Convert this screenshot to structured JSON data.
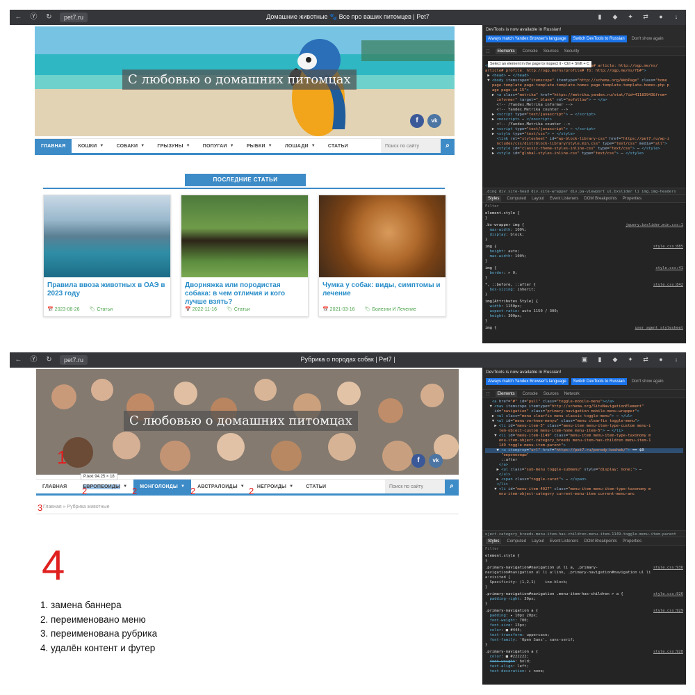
{
  "shot1": {
    "browser": {
      "url": "pet7.ru",
      "title": "Домашние животные 🐾 Все про ваших питомцев | Pet7"
    },
    "banner": {
      "caption": "С любовью о домашних питомцах",
      "social": [
        "f",
        "vk"
      ]
    },
    "menu": {
      "items": [
        {
          "label": "ГЛАВНАЯ",
          "active": true,
          "caret": false
        },
        {
          "label": "КОШКИ",
          "caret": true
        },
        {
          "label": "СОБАКИ",
          "caret": true
        },
        {
          "label": "ГРЫЗУНЫ",
          "caret": true
        },
        {
          "label": "ПОПУГАИ",
          "caret": true
        },
        {
          "label": "РЫБКИ",
          "caret": true
        },
        {
          "label": "ЛОШАДИ",
          "caret": true
        },
        {
          "label": "СТАТЬИ",
          "caret": false
        }
      ],
      "search_placeholder": "Поиск по сайту"
    },
    "latest_heading": "ПОСЛЕДНИЕ СТАТЬИ",
    "cards": [
      {
        "title": "Правила ввоза животных в ОАЭ в 2023 году",
        "date": "2023-08-26",
        "category": "Статьи"
      },
      {
        "title": "Дворняжка или породистая собака: в чем отличия и кого лучше взять?",
        "date": "2022-11-16",
        "category": "Статьи"
      },
      {
        "title": "Чумка у собак: виды, симптомы и лечение",
        "date": "2021-03-16",
        "category": "Болезни И Лечение"
      }
    ],
    "devtools": {
      "notice": "DevTools is now available in Russian!",
      "btn_match": "Always match Yandex Browser's language",
      "btn_switch": "Switch DevTools to Russian",
      "btn_dismiss": "Don't show again",
      "tabs": [
        "Elements",
        "Console",
        "Sources",
        "Security"
      ],
      "tooltip": "Select an element in the page to inspect it - Ctrl + Shift + C",
      "crumbs": ".ding  div.site-head  div.site-wrapper  div.pa-viewport  ul.bxslider  li  img.img-headers",
      "style_tabs": [
        "Styles",
        "Computed",
        "Layout",
        "Event Listeners",
        "DOM Breakpoints",
        "Properties"
      ],
      "filter": "Filter"
    }
  },
  "shot2": {
    "browser": {
      "url": "pet7.ru",
      "title": "Рубрика о породах собак | Pet7 |"
    },
    "banner": {
      "caption": "С любовью о домашних питомцах"
    },
    "menu": {
      "items": [
        {
          "label": "ГЛАВНАЯ",
          "caret": false
        },
        {
          "label": "ЕВРОПЕОИДЫ",
          "caret": true
        },
        {
          "label": "МОНГОЛОИДЫ",
          "caret": true,
          "active": true
        },
        {
          "label": "АВСТРАЛОИДЫ",
          "caret": true
        },
        {
          "label": "НЕГРОИДЫ",
          "caret": true
        },
        {
          "label": "СТАТЬИ",
          "caret": false
        }
      ],
      "search_placeholder": "Поиск по сайту"
    },
    "tooltip": "P.text  94.25 × 18",
    "breadcrumb": "Главная » Рубрика животные",
    "markers": {
      "one": "1",
      "two": "2",
      "three": "3"
    },
    "big_number": "4",
    "notes": [
      "1. замена баннера",
      "2. переименовано меню",
      "3. переименована рубрика",
      "4. удалён контент и футер"
    ]
  },
  "colors": {
    "accent": "#3d8bc7",
    "marker": "#e02020",
    "link": "#2a8ec9",
    "meta": "#4aa24a"
  }
}
